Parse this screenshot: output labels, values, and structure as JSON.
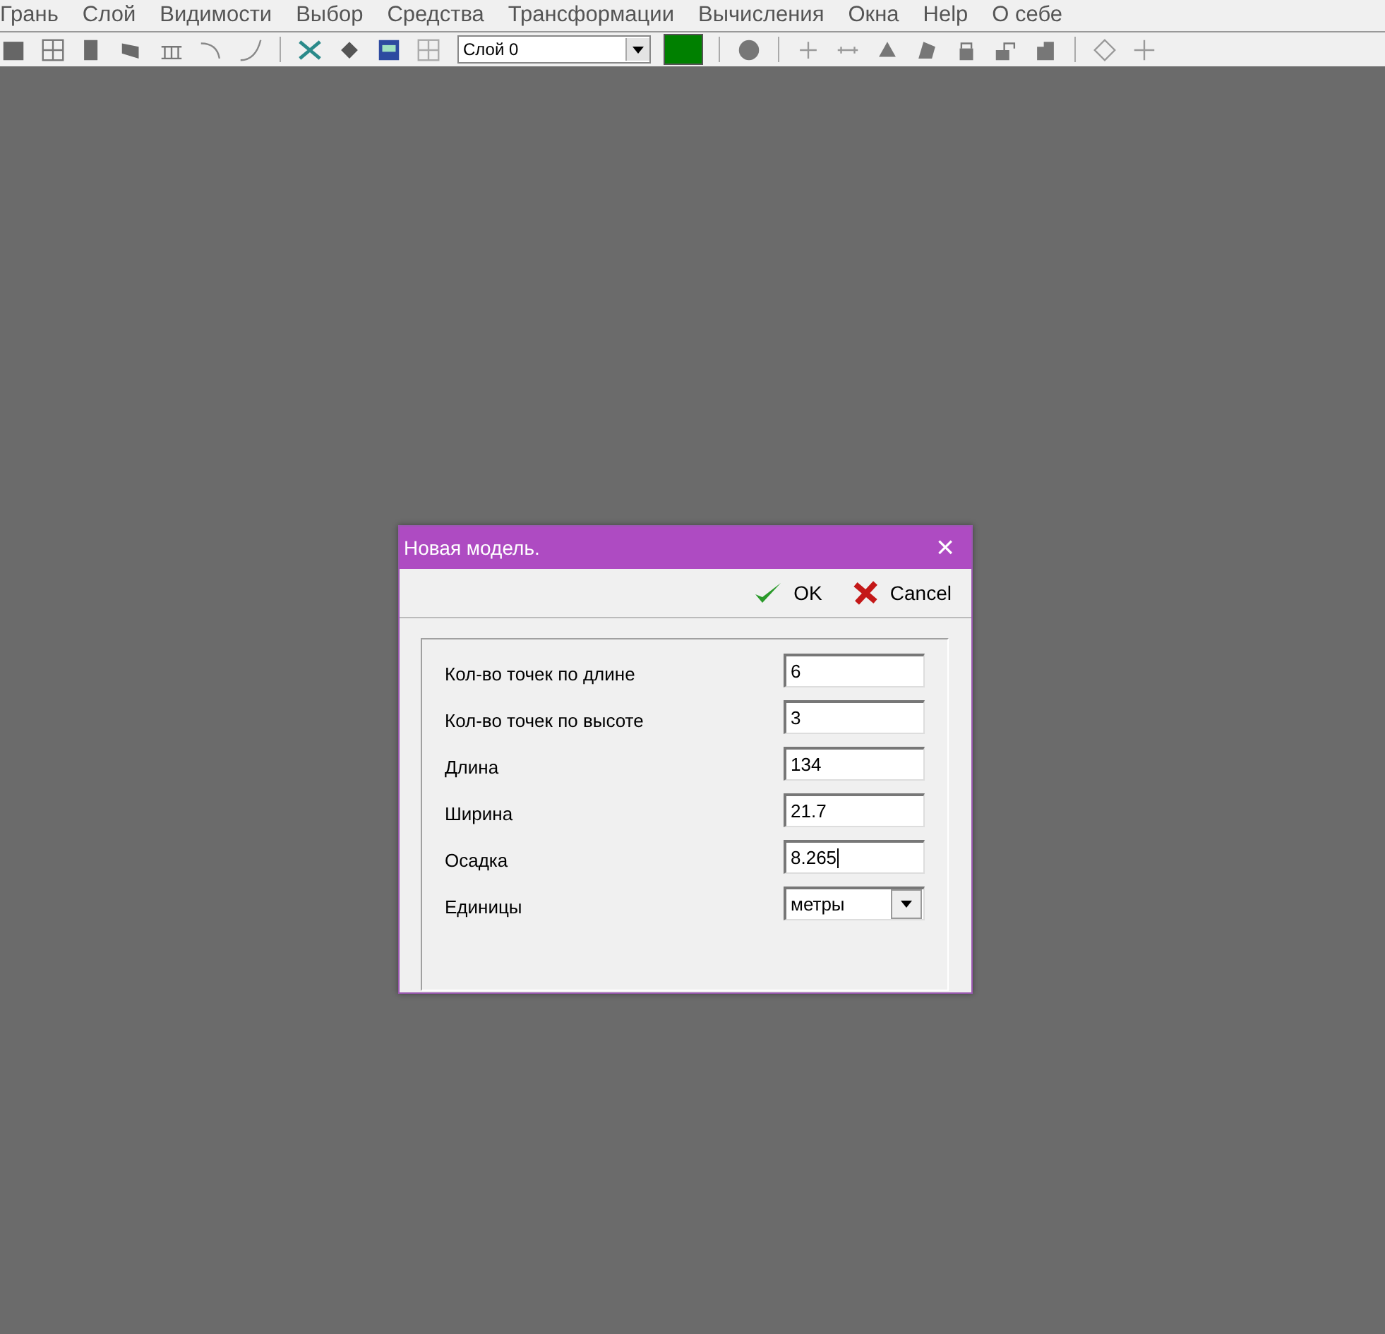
{
  "menu": [
    "Грань",
    "Слой",
    "Видимости",
    "Выбор",
    "Средства",
    "Трансформации",
    "Вычисления",
    "Окна",
    "Help",
    "О себе"
  ],
  "toolbar": {
    "layer": "Слой 0",
    "color": "#008000"
  },
  "dialog": {
    "title": "Новая модель.",
    "close": "×",
    "ok": "OK",
    "cancel": "Cancel",
    "fields": [
      {
        "label": "Кол-во точек по длине",
        "value": "6",
        "kind": "text"
      },
      {
        "label": "Кол-во точек по высоте",
        "value": "3",
        "kind": "text"
      },
      {
        "label": "Длина",
        "value": "134",
        "kind": "text"
      },
      {
        "label": "Ширина",
        "value": "21.7",
        "kind": "text"
      },
      {
        "label": "Осадка",
        "value": "8.265",
        "kind": "text",
        "focused": true
      },
      {
        "label": "Единицы",
        "value": "метры",
        "kind": "select"
      }
    ]
  }
}
